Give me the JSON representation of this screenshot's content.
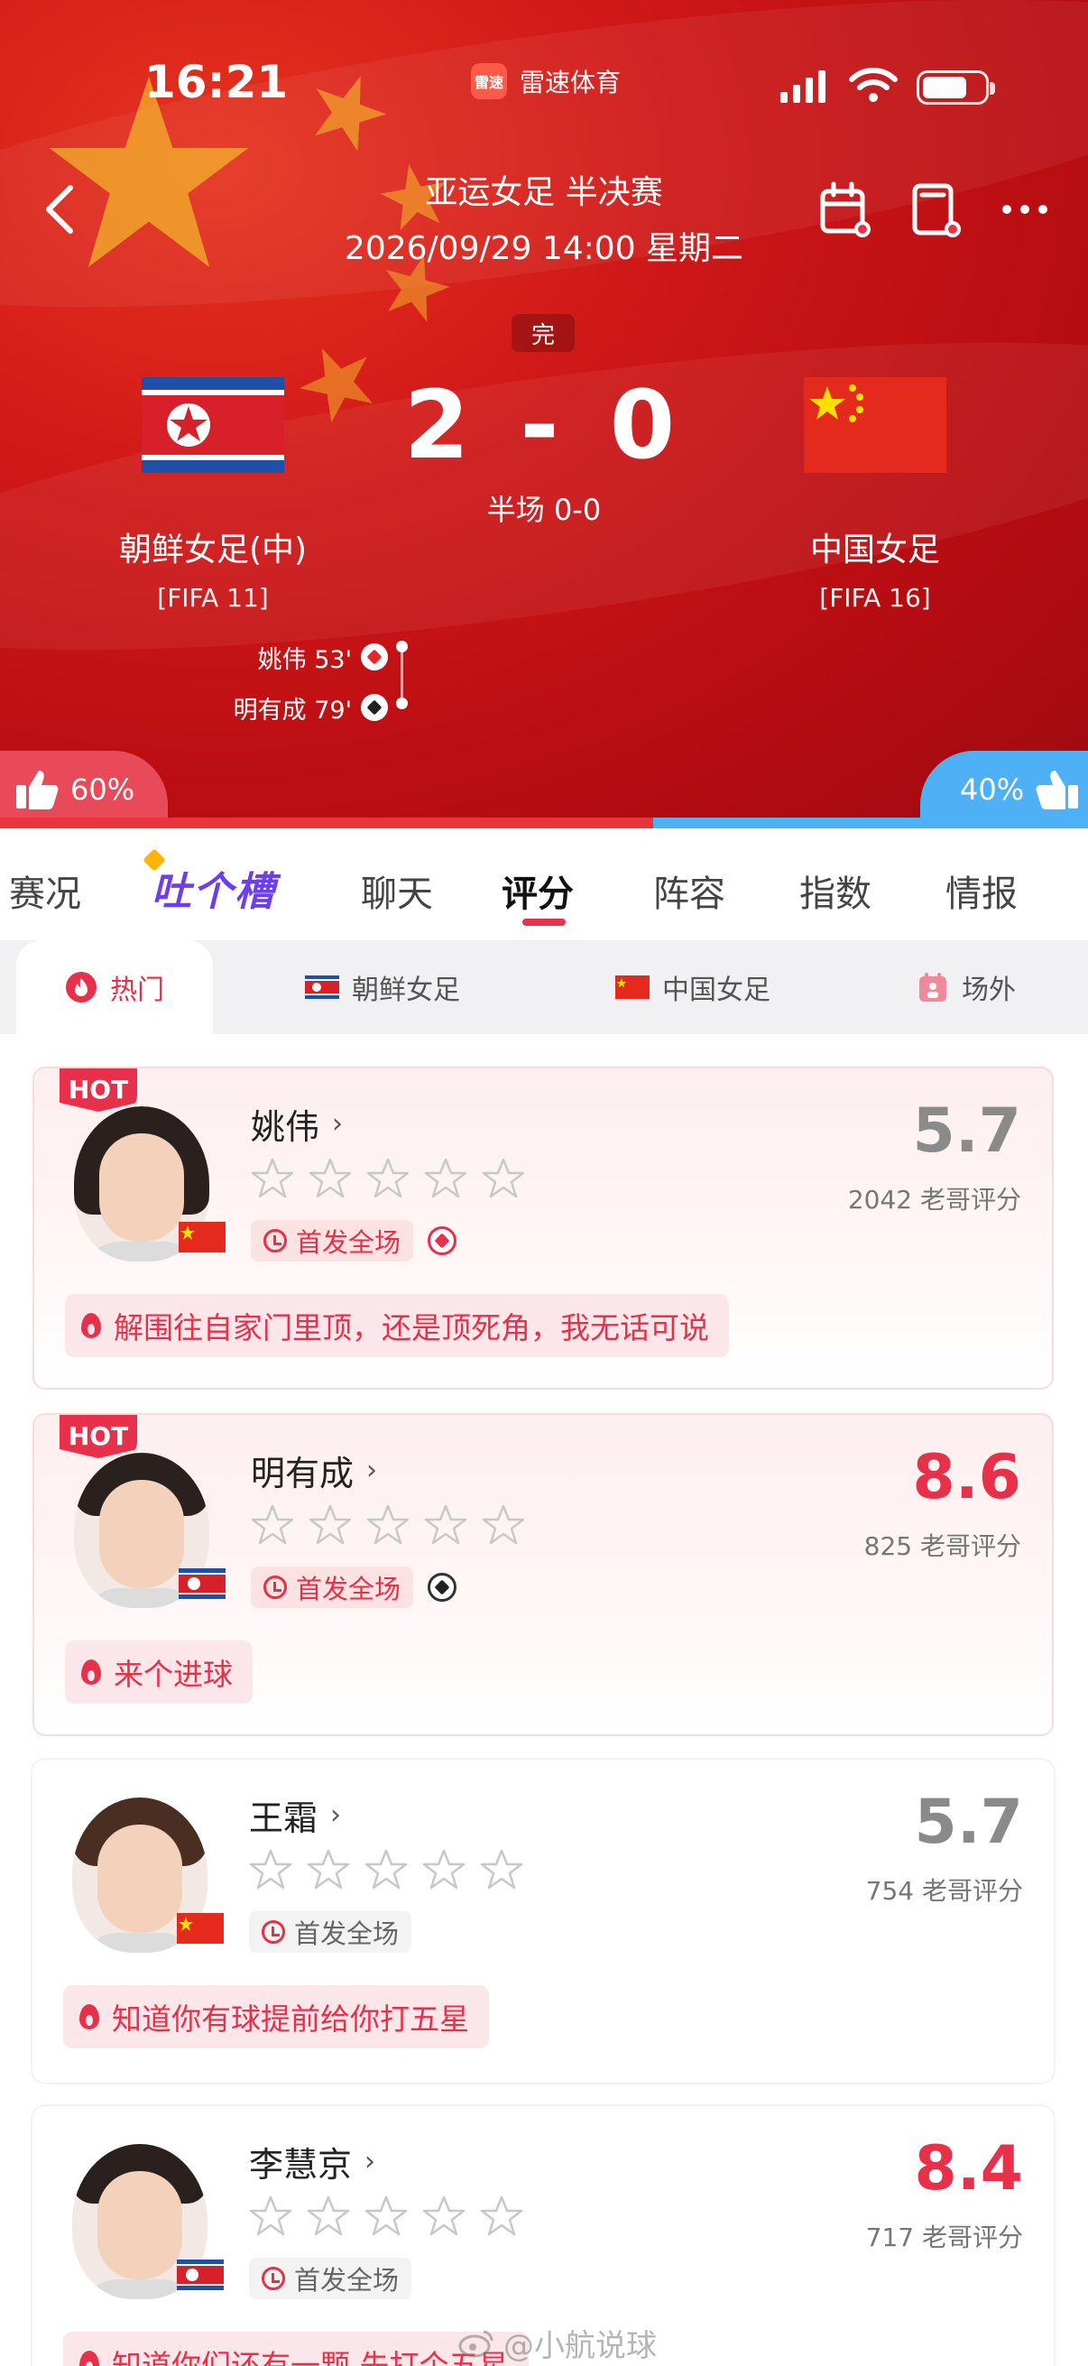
{
  "status_bar": {
    "time": "16:21",
    "app_name": "雷速体育",
    "app_logo_text": "雷速"
  },
  "match": {
    "league": "亚运女足 半决赛",
    "datetime": "2026/09/29 14:00 星期二",
    "status": "完",
    "score": "2 - 0",
    "halftime": "半场 0-0",
    "home": {
      "name": "朝鲜女足(中)",
      "fifa": "[FIFA 11]",
      "flag": "north-korea-flag"
    },
    "away": {
      "name": "中国女足",
      "fifa": "[FIFA 16]",
      "flag": "china-flag"
    },
    "scorers": [
      {
        "text": "姚伟 53'",
        "type": "own-goal"
      },
      {
        "text": "明有成 79'",
        "type": "goal"
      }
    ],
    "vote_home": "60%",
    "vote_away": "40%",
    "vote_home_fraction": 0.6
  },
  "tabs": [
    {
      "label": "赛况",
      "active": false
    },
    {
      "label": "吐个槽",
      "active": false
    },
    {
      "label": "聊天",
      "active": false
    },
    {
      "label": "评分",
      "active": true
    },
    {
      "label": "阵容",
      "active": false
    },
    {
      "label": "指数",
      "active": false
    },
    {
      "label": "情报",
      "active": false
    }
  ],
  "subtabs": [
    {
      "label": "热门",
      "icon": "fire-icon",
      "active": true
    },
    {
      "label": "朝鲜女足",
      "icon": "north-korea-flag",
      "active": false
    },
    {
      "label": "中国女足",
      "icon": "china-flag",
      "active": false
    },
    {
      "label": "场外",
      "icon": "offfield-icon",
      "active": false
    }
  ],
  "players": [
    {
      "name": "姚伟",
      "hot": "HOT",
      "rating": "5.7",
      "rating_color": "#8a8a8a",
      "votes": "2042 老哥评分",
      "role": "首发全场",
      "event": "own-goal",
      "flag": "china",
      "comment": "解围往自家门里顶，还是顶死角，我无话可说",
      "stars": 0
    },
    {
      "name": "明有成",
      "hot": "HOT",
      "rating": "8.6",
      "rating_color": "#e8304a",
      "votes": "825 老哥评分",
      "role": "首发全场",
      "event": "goal",
      "flag": "north-korea",
      "comment": "来个进球",
      "stars": 0
    },
    {
      "name": "王霜",
      "hot": "",
      "rating": "5.7",
      "rating_color": "#8a8a8a",
      "votes": "754 老哥评分",
      "role": "首发全场",
      "event": "",
      "flag": "china",
      "comment": "知道你有球提前给你打五星",
      "stars": 0
    },
    {
      "name": "李慧京",
      "hot": "",
      "rating": "8.4",
      "rating_color": "#e8304a",
      "votes": "717 老哥评分",
      "role": "首发全场",
      "event": "",
      "flag": "north-korea",
      "comment": "知道你们还有一颗 先打个五星",
      "stars": 0
    }
  ],
  "watermark": "@小航说球",
  "colors": {
    "accent": "#e8304a",
    "hero_red": "#d01818",
    "away_blue": "#4eb0f5",
    "tucao_purple": "#6d3df0"
  }
}
